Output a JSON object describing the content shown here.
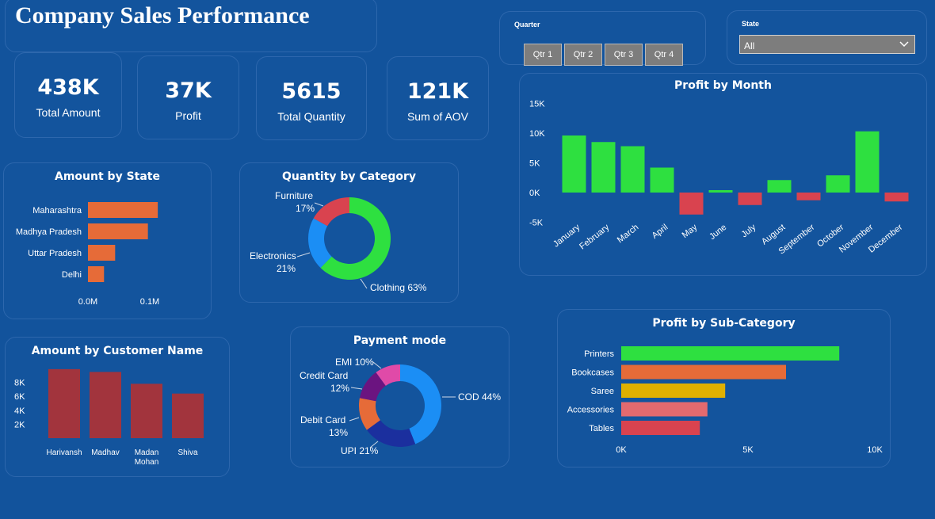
{
  "page": {
    "title": "Company Sales Performance"
  },
  "kpis": [
    {
      "value": "438K",
      "label": "Total Amount"
    },
    {
      "value": "37K",
      "label": "Profit"
    },
    {
      "value": "5615",
      "label": "Total Quantity"
    },
    {
      "value": "121K",
      "label": "Sum of AOV"
    }
  ],
  "slicers": {
    "quarter": {
      "label": "Quarter",
      "options": [
        "Qtr 1",
        "Qtr 2",
        "Qtr 3",
        "Qtr 4"
      ]
    },
    "state": {
      "label": "State",
      "selected": "All"
    }
  },
  "colors": {
    "background": "#12539c",
    "positive": "#2ee040",
    "negative": "#d9434f",
    "bar_orange": "#e66b38",
    "bar_maroon": "#a2343d"
  },
  "chart_data": [
    {
      "id": "profit_by_month",
      "type": "bar",
      "title": "Profit by Month",
      "categories": [
        "January",
        "February",
        "March",
        "April",
        "May",
        "June",
        "July",
        "August",
        "September",
        "October",
        "November",
        "December"
      ],
      "values": [
        9600,
        8500,
        7800,
        4200,
        -3700,
        400,
        -2100,
        2100,
        -1300,
        2900,
        10300,
        -1500
      ],
      "yticks": [
        "15K",
        "10K",
        "5K",
        "0K",
        "-5K"
      ],
      "ylim": [
        -5000,
        15000
      ]
    },
    {
      "id": "amount_by_state",
      "type": "bar",
      "orientation": "horizontal",
      "title": "Amount by State",
      "categories": [
        "Maharashtra",
        "Madhya Pradesh",
        "Uttar Pradesh",
        "Delhi"
      ],
      "values": [
        0.113,
        0.097,
        0.044,
        0.026
      ],
      "xticks": [
        "0.0M",
        "0.1M"
      ]
    },
    {
      "id": "quantity_by_category",
      "type": "pie",
      "title": "Quantity by Category",
      "slices": [
        {
          "name": "Clothing",
          "value": 63,
          "label": "Clothing 63%",
          "color": "#2ee040"
        },
        {
          "name": "Electronics",
          "value": 21,
          "label": "Electronics",
          "pct": "21%",
          "color": "#1b8ef5"
        },
        {
          "name": "Furniture",
          "value": 17,
          "label": "Furniture",
          "pct": "17%",
          "color": "#d9434f"
        }
      ]
    },
    {
      "id": "amount_by_customer",
      "type": "bar",
      "title": "Amount by Customer Name",
      "categories": [
        "Harivansh",
        "Madhav",
        "Madan Mohan",
        "Shiva"
      ],
      "category_lines": [
        [
          "Harivansh"
        ],
        [
          "Madhav"
        ],
        [
          "Madan",
          "Mohan"
        ],
        [
          "Shiva"
        ]
      ],
      "values": [
        9900,
        9500,
        7800,
        6400
      ],
      "yticks": [
        "8K",
        "6K",
        "4K",
        "2K"
      ]
    },
    {
      "id": "payment_mode",
      "type": "pie",
      "title": "Payment mode",
      "slices": [
        {
          "name": "COD",
          "value": 44,
          "label": "COD 44%",
          "color": "#1b8ef5"
        },
        {
          "name": "UPI",
          "value": 21,
          "label": "UPI 21%",
          "color": "#1b2f9e"
        },
        {
          "name": "Debit Card",
          "value": 13,
          "label": "Debit Card",
          "pct": "13%",
          "color": "#e66b38"
        },
        {
          "name": "Credit Card",
          "value": 12,
          "label": "Credit Card",
          "pct": "12%",
          "color": "#6b1480"
        },
        {
          "name": "EMI",
          "value": 10,
          "label": "EMI 10%",
          "color": "#e04aa8"
        }
      ]
    },
    {
      "id": "profit_by_subcategory",
      "type": "bar",
      "orientation": "horizontal",
      "title": "Profit by Sub-Category",
      "categories": [
        "Printers",
        "Bookcases",
        "Saree",
        "Accessories",
        "Tables"
      ],
      "values": [
        8600,
        6500,
        4100,
        3400,
        3100
      ],
      "colors": [
        "#2ee040",
        "#e66b38",
        "#e0b000",
        "#e36a6f",
        "#d9434f"
      ],
      "xticks": [
        "0K",
        "5K",
        "10K"
      ],
      "xlim": [
        0,
        10000
      ]
    }
  ]
}
